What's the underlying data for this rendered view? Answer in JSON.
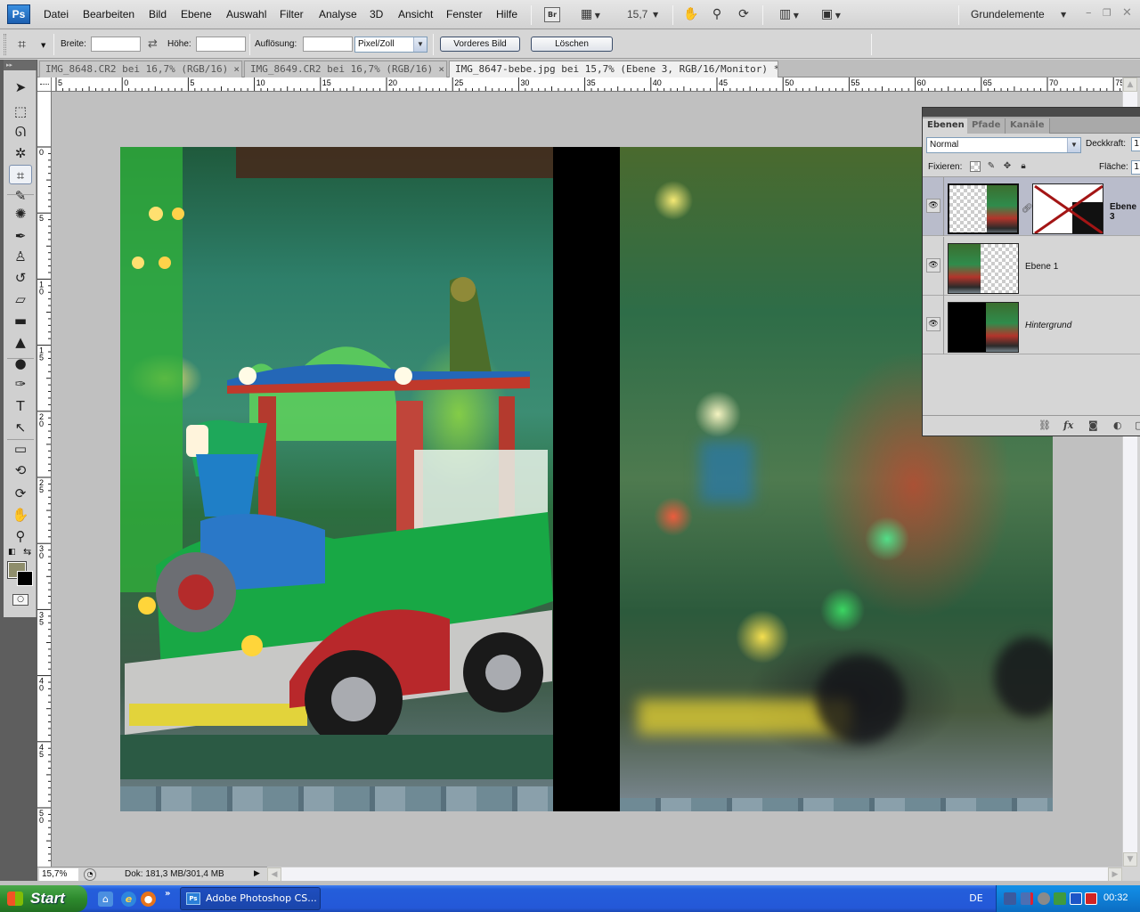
{
  "app": {
    "logo": "Ps",
    "menu": [
      "Datei",
      "Bearbeiten",
      "Bild",
      "Ebene",
      "Auswahl",
      "Filter",
      "Analyse",
      "3D",
      "Ansicht",
      "Fenster",
      "Hilfe"
    ],
    "bridge_label": "Br",
    "zoom_value": "15,7",
    "workspace": "Grundelemente",
    "window_controls": {
      "minimize": "–",
      "restore": "❐",
      "close": "✕"
    }
  },
  "options_bar": {
    "tool_icon": "crop-icon",
    "width_label": "Breite:",
    "width_value": "",
    "swap_icon": "⇄",
    "height_label": "Höhe:",
    "height_value": "",
    "resolution_label": "Auflösung:",
    "resolution_value": "",
    "resolution_unit": "Pixel/Zoll",
    "front_image_button": "Vorderes Bild",
    "clear_button": "Löschen"
  },
  "tabs": [
    {
      "label": "IMG_8648.CR2 bei 16,7% (RGB/16)",
      "active": false
    },
    {
      "label": "IMG_8649.CR2 bei 16,7% (RGB/16)",
      "active": false
    },
    {
      "label": "IMG_8647-bebe.jpg bei 15,7% (Ebene 3, RGB/16/Monitor) *",
      "active": true
    }
  ],
  "tab_close": "×",
  "ruler_h": [
    "5",
    "0",
    "5",
    "10",
    "15",
    "20",
    "25",
    "30",
    "35",
    "40",
    "45",
    "50",
    "55",
    "60",
    "65",
    "70",
    "75"
  ],
  "ruler_v": [
    "0",
    "5",
    "10",
    "15",
    "20",
    "25",
    "30",
    "35",
    "40",
    "45",
    "50"
  ],
  "tools": [
    {
      "name": "move-tool",
      "glyph": "➤"
    },
    {
      "name": "marquee-tool",
      "glyph": "⬚"
    },
    {
      "name": "lasso-tool",
      "glyph": "ᘏ"
    },
    {
      "name": "magic-wand-tool",
      "glyph": "✲"
    },
    {
      "name": "crop-tool",
      "glyph": "⌗",
      "active": true
    },
    {
      "name": "eyedropper-tool",
      "glyph": "✎"
    },
    {
      "name": "healing-brush-tool",
      "glyph": "✺"
    },
    {
      "name": "brush-tool",
      "glyph": "✒"
    },
    {
      "name": "clone-stamp-tool",
      "glyph": "♙"
    },
    {
      "name": "history-brush-tool",
      "glyph": "↺"
    },
    {
      "name": "eraser-tool",
      "glyph": "▱"
    },
    {
      "name": "gradient-tool",
      "glyph": "▬"
    },
    {
      "name": "blur-tool",
      "glyph": "▲"
    },
    {
      "name": "dodge-tool",
      "glyph": "●"
    },
    {
      "name": "pen-tool",
      "glyph": "✑"
    },
    {
      "name": "type-tool",
      "glyph": "T"
    },
    {
      "name": "path-selection-tool",
      "glyph": "↖"
    },
    {
      "name": "shape-tool",
      "glyph": "▭"
    },
    {
      "name": "3d-rotate-tool",
      "glyph": "⟲"
    },
    {
      "name": "3d-orbit-tool",
      "glyph": "⟳"
    },
    {
      "name": "hand-tool",
      "glyph": "✋"
    },
    {
      "name": "zoom-tool",
      "glyph": "⚲"
    }
  ],
  "colors": {
    "foreground": "#8f8e6c",
    "background": "#000000"
  },
  "status": {
    "zoom": "15,7%",
    "doc_size": "Dok: 181,3 MB/301,4 MB"
  },
  "layers_panel": {
    "tabs": [
      "Ebenen",
      "Pfade",
      "Kanäle"
    ],
    "blend_mode": "Normal",
    "opacity_label": "Deckkraft:",
    "opacity_value": "1",
    "lock_label": "Fixieren:",
    "fill_label": "Fläche:",
    "fill_value": "1",
    "layers": [
      {
        "name": "Ebene 3",
        "visible": true,
        "selected": true,
        "has_mask": true
      },
      {
        "name": "Ebene 1",
        "visible": true,
        "selected": false,
        "has_mask": false
      },
      {
        "name": "Hintergrund",
        "visible": true,
        "selected": false,
        "has_mask": false
      }
    ],
    "footer_icons": [
      "link-icon",
      "fx-icon",
      "mask-icon",
      "adjustment-icon"
    ]
  },
  "taskbar": {
    "start_label": "Start",
    "task_label": "Adobe Photoshop CS...",
    "chevron": "»",
    "language": "DE",
    "clock": "00:32"
  }
}
